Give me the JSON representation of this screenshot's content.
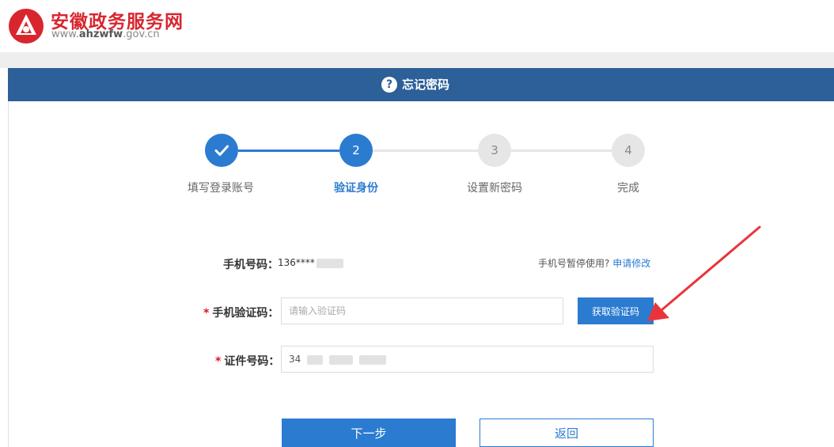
{
  "header": {
    "site_name": "安徽政务服务网",
    "url_prefix": "www.",
    "url_domain": "ahzwfw",
    "url_suffix": ".gov.cn",
    "logo_icon": "ahzwfw-logo-icon"
  },
  "panel": {
    "title": "忘记密码",
    "title_icon": "question-circle-icon"
  },
  "steps": [
    {
      "number": "",
      "label": "填写登录账号",
      "state": "done"
    },
    {
      "number": "2",
      "label": "验证身份",
      "state": "active"
    },
    {
      "number": "3",
      "label": "设置新密码",
      "state": "pending"
    },
    {
      "number": "4",
      "label": "完成",
      "state": "pending"
    }
  ],
  "form": {
    "phone_label": "手机号码：",
    "phone_value": "136****",
    "phone_note": "手机号暂停使用?",
    "phone_note_link": "申请修改",
    "sms_label": "手机验证码：",
    "sms_placeholder": "请输入验证码",
    "get_code_button": "获取验证码",
    "id_label": "证件号码：",
    "id_value": "34",
    "required_mark": "*"
  },
  "actions": {
    "next": "下一步",
    "back": "返回"
  },
  "colors": {
    "brand_red": "#d8262f",
    "titlebar_blue": "#2d5f98",
    "primary_blue": "#2b7bd1",
    "annotation_arrow": "#e8353b"
  }
}
